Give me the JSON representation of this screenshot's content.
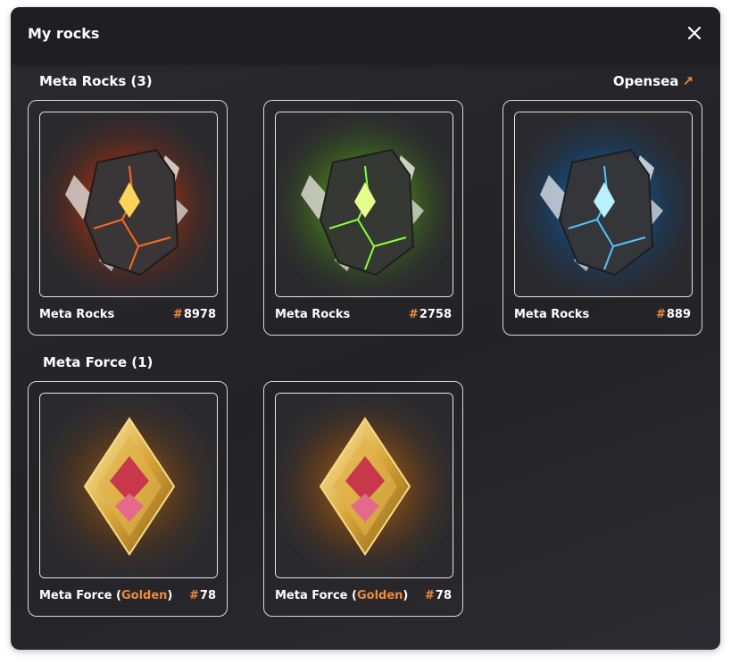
{
  "header": {
    "title": "My rocks"
  },
  "sections": {
    "rocks": {
      "title": "Meta Rocks (3)"
    },
    "force": {
      "title": "Meta Force (1)"
    }
  },
  "opensea": {
    "label": "Opensea",
    "arrow": "↗"
  },
  "rock_cards": [
    {
      "name": "Meta Rocks",
      "hash": "#",
      "number": "8978",
      "glow": "red",
      "glow_color": "#ff5a1e"
    },
    {
      "name": "Meta Rocks",
      "hash": "#",
      "number": "2758",
      "glow": "green",
      "glow_color": "#7cff2a"
    },
    {
      "name": "Meta Rocks",
      "hash": "#",
      "number": "889",
      "glow": "blue",
      "glow_color": "#3ab6ff"
    }
  ],
  "force_cards": [
    {
      "name": "Meta Force",
      "paren_open": "(",
      "variant": "Golden",
      "paren_close": ")",
      "hash": "#",
      "number": "78"
    },
    {
      "name": "Meta Force",
      "paren_open": "(",
      "variant": "Golden",
      "paren_close": ")",
      "hash": "#",
      "number": "78"
    }
  ],
  "colors": {
    "accent": "#f08a3c",
    "background": "#26262a",
    "header": "#1f1f23"
  },
  "icons": {
    "close": "close-icon",
    "external": "external-link-icon"
  }
}
